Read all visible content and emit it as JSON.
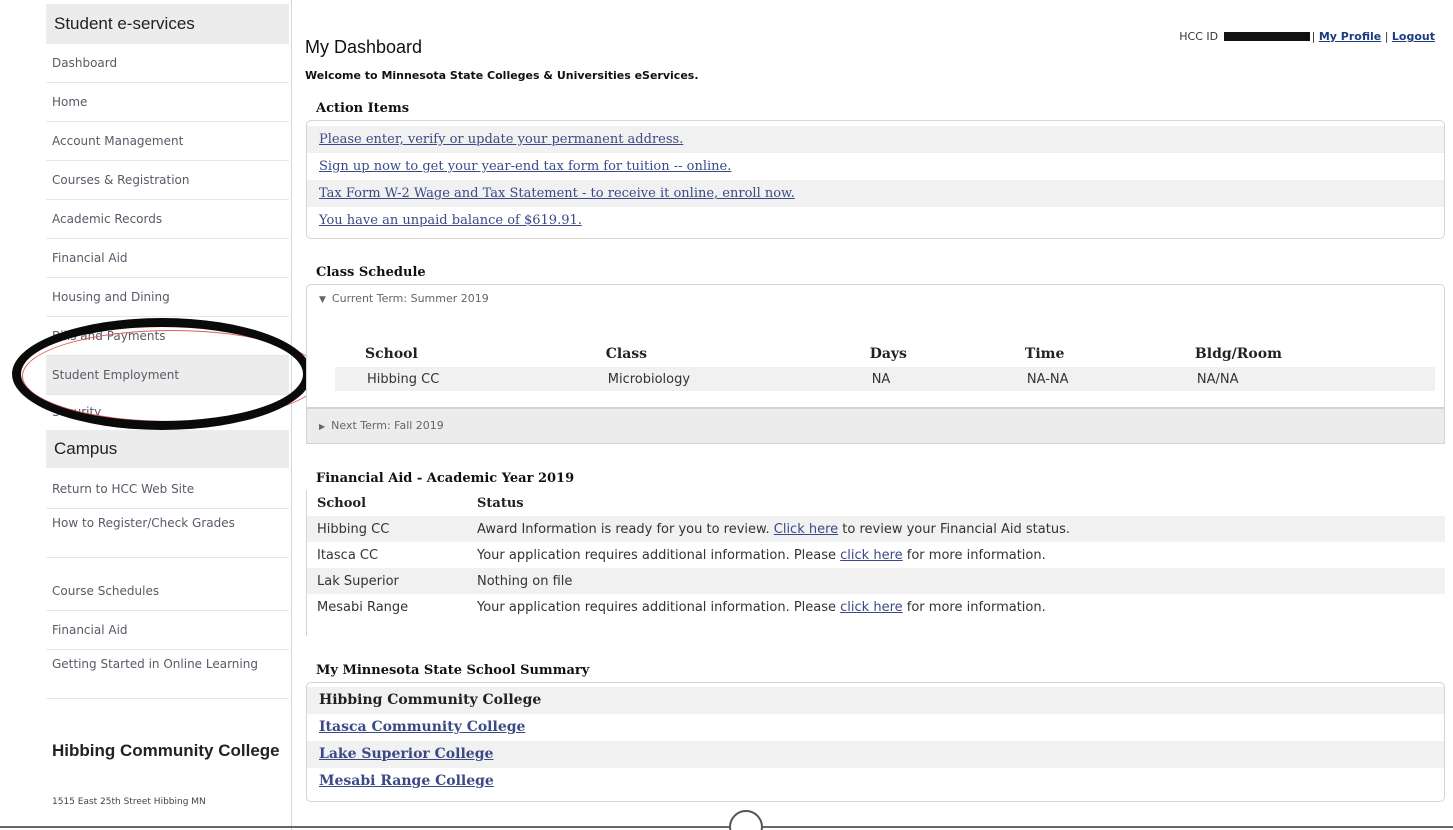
{
  "sidebar": {
    "header": "Student e-services",
    "items": [
      {
        "label": "Dashboard"
      },
      {
        "label": "Home"
      },
      {
        "label": "Account Management"
      },
      {
        "label": "Courses & Registration"
      },
      {
        "label": "Academic Records"
      },
      {
        "label": "Financial Aid"
      },
      {
        "label": "Housing and Dining"
      },
      {
        "label": "Bills and Payments"
      },
      {
        "label": "Student Employment"
      },
      {
        "label": "Security"
      }
    ],
    "campus_header": "Campus",
    "campus_items": [
      {
        "label": "Return to HCC Web Site"
      },
      {
        "label": "How to Register/Check Grades"
      },
      {
        "label": "Course Schedules"
      },
      {
        "label": "Financial Aid"
      },
      {
        "label": "Getting Started in Online Learning"
      }
    ],
    "org_name": "Hibbing Community College",
    "address": "1515 East 25th Street Hibbing MN"
  },
  "header": {
    "title": "My Dashboard",
    "id_label": "HCC ID",
    "profile_link": "My Profile",
    "logout_link": "Logout",
    "welcome": "Welcome to Minnesota State Colleges & Universities eServices."
  },
  "action_items": {
    "title": "Action Items",
    "links": [
      "Please enter, verify or update your permanent address.",
      "Sign up now to get your year-end tax form for tuition -- online.",
      "Tax Form W-2 Wage and Tax Statement - to receive it online, enroll now.",
      "You have an unpaid balance of $619.91."
    ]
  },
  "class_schedule": {
    "title": "Class Schedule",
    "current_term": "Current Term: Summer 2019",
    "next_term": "Next Term: Fall 2019",
    "columns": [
      "School",
      "Class",
      "Days",
      "Time",
      "Bldg/Room"
    ],
    "rows": [
      [
        "Hibbing CC",
        "Microbiology",
        "NA",
        "NA-NA",
        "NA/NA"
      ]
    ]
  },
  "financial_aid": {
    "title": "Financial Aid - Academic Year 2019",
    "columns": [
      "School",
      "Status"
    ],
    "rows": [
      {
        "school": "Hibbing CC",
        "before": "Award Information is ready for you to review. ",
        "link": "Click here",
        "after": " to review your Financial Aid status."
      },
      {
        "school": "Itasca CC",
        "before": "Your application requires additional information. Please ",
        "link": "click here",
        "after": " for more information."
      },
      {
        "school": "Lak Superior",
        "before": "Nothing on file",
        "link": "",
        "after": ""
      },
      {
        "school": "Mesabi Range",
        "before": "Your application requires additional information. Please ",
        "link": "click here",
        "after": " for more information."
      }
    ]
  },
  "school_summary": {
    "title": "My Minnesota State School Summary",
    "schools": [
      "Hibbing Community College",
      "Itasca Community College",
      "Lake Superior College",
      "Mesabi Range College"
    ]
  },
  "colors": {
    "link": "#3b4a86",
    "sidebar_text": "#555c66",
    "highlight_bg": "#ececec",
    "annotation": "#0a0a0a"
  }
}
